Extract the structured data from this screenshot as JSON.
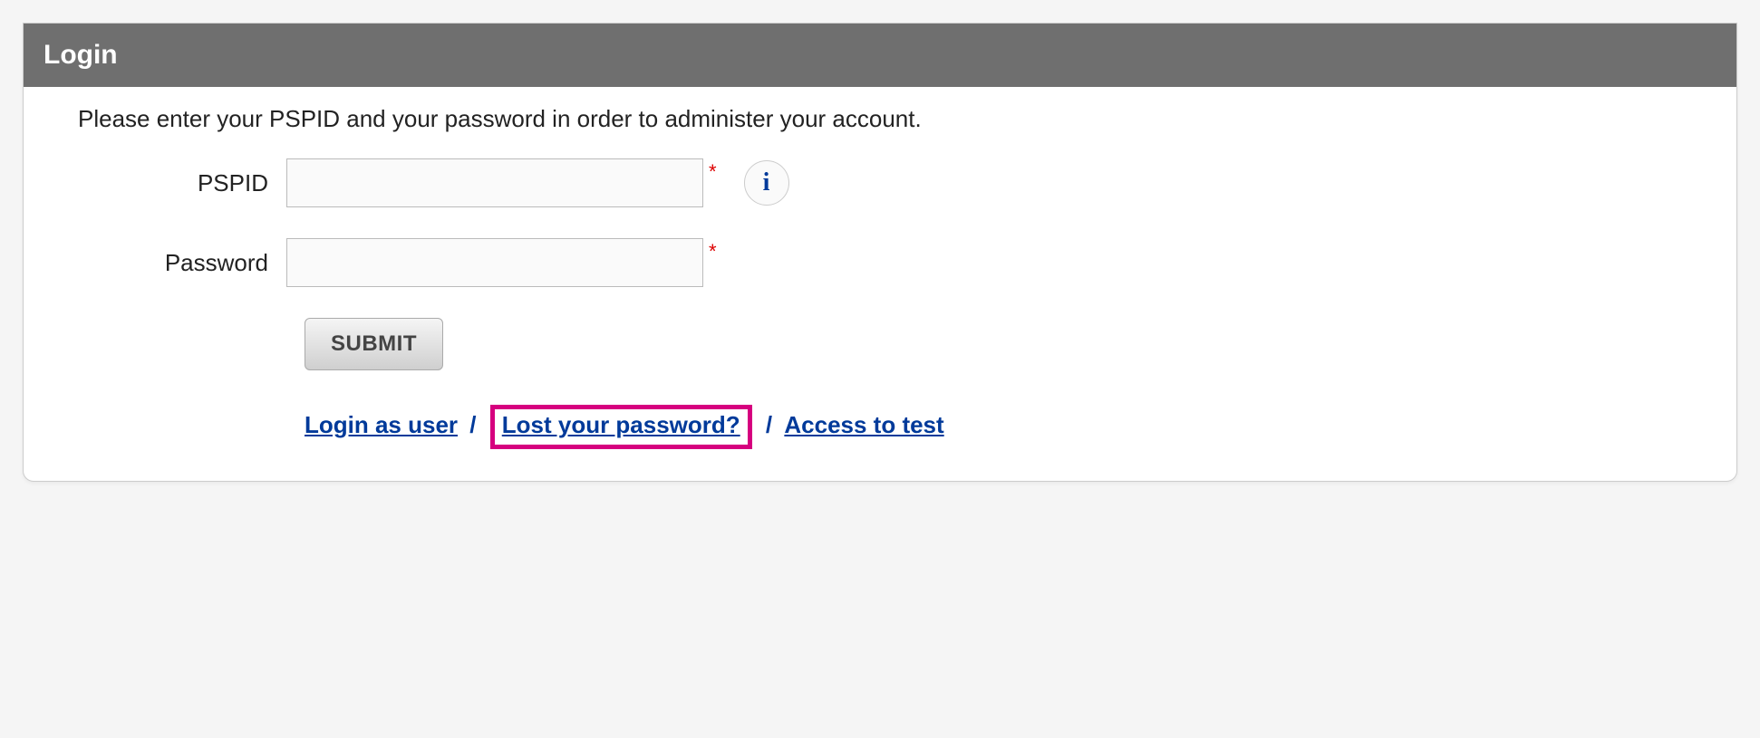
{
  "header": {
    "title": "Login"
  },
  "instruction": "Please enter your PSPID and your password in order to administer your account.",
  "fields": {
    "pspid": {
      "label": "PSPID",
      "value": "",
      "required_mark": "*"
    },
    "password": {
      "label": "Password",
      "value": "",
      "required_mark": "*"
    }
  },
  "submit_label": "SUBMIT",
  "links": {
    "login_as_user": "Login as user",
    "lost_password": "Lost your password?",
    "access_to_test": "Access to test",
    "separator": "/"
  },
  "info_icon_glyph": "i"
}
